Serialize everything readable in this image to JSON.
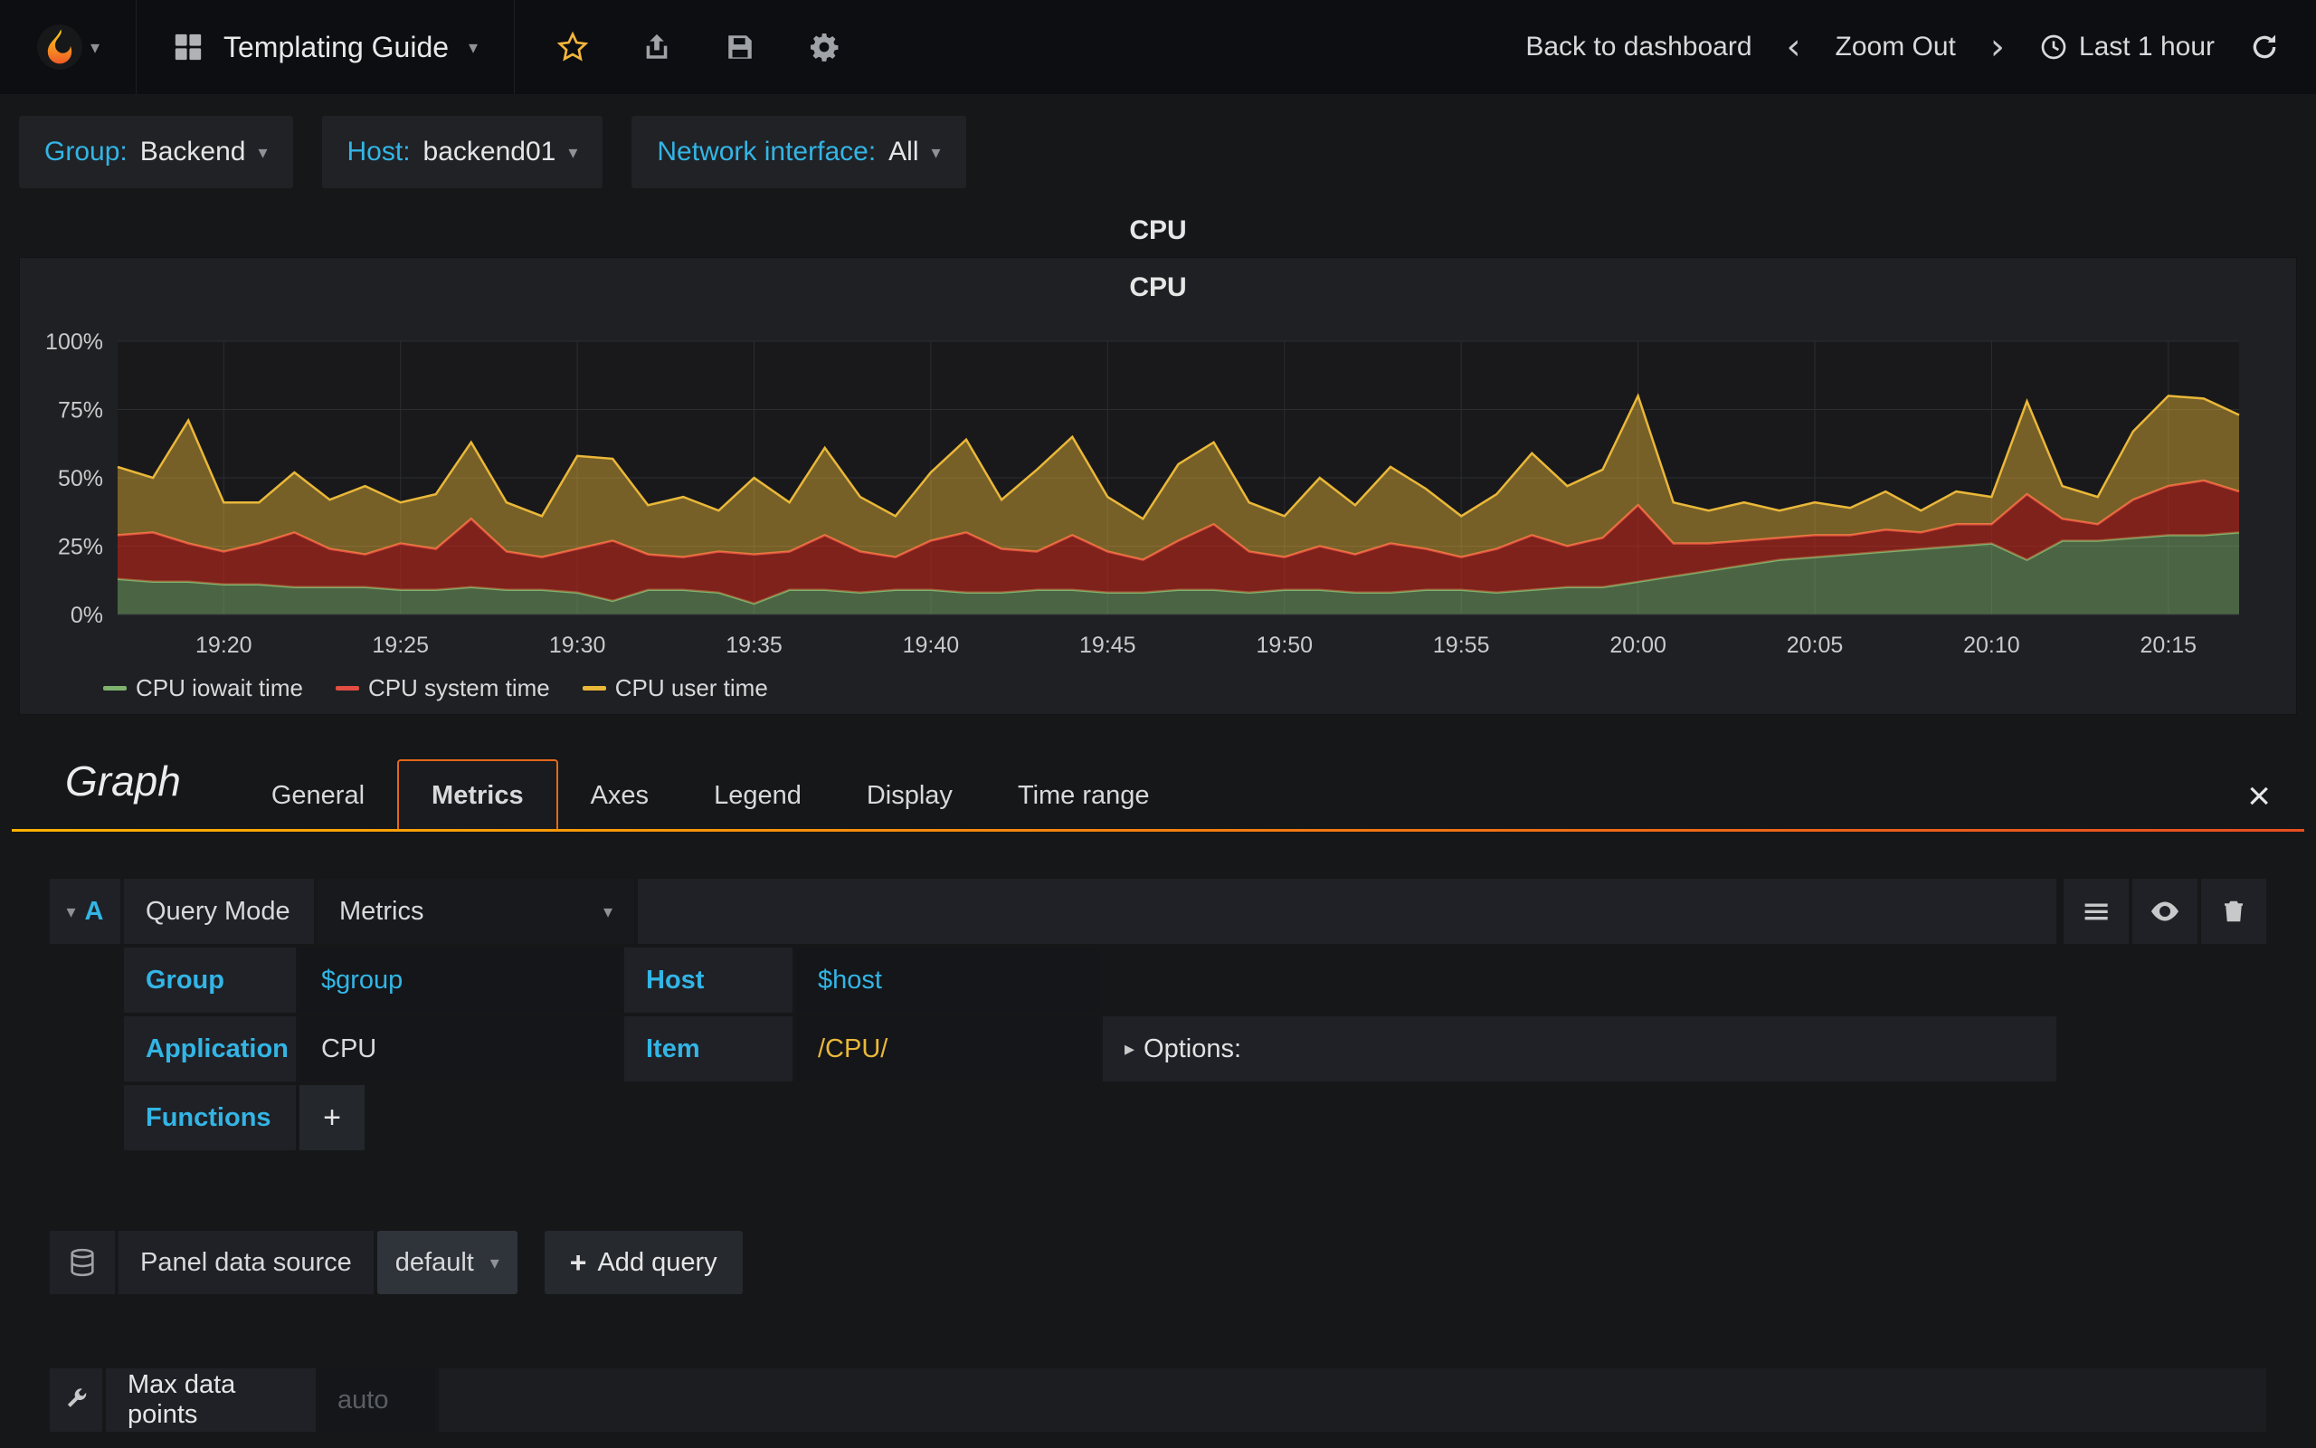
{
  "navbar": {
    "title": "Templating Guide",
    "back_to_dashboard": "Back to dashboard",
    "zoom_out": "Zoom Out",
    "time_range": "Last 1 hour"
  },
  "variables": [
    {
      "label": "Group:",
      "value": "Backend"
    },
    {
      "label": "Host:",
      "value": "backend01"
    },
    {
      "label": "Network interface:",
      "value": "All"
    }
  ],
  "panel": {
    "row_title": "CPU",
    "graph_title": "CPU"
  },
  "chart_data": {
    "type": "area",
    "stacked": true,
    "title": "CPU",
    "ylim": [
      0,
      100
    ],
    "y_ticks": [
      "0%",
      "25%",
      "50%",
      "75%",
      "100%"
    ],
    "x_ticks": [
      "19:20",
      "19:25",
      "19:30",
      "19:35",
      "19:40",
      "19:45",
      "19:50",
      "19:55",
      "20:00",
      "20:05",
      "20:10",
      "20:15"
    ],
    "first_tick_index": 3,
    "tick_step": 5,
    "x_start": "19:17",
    "x_end": "20:17",
    "grid": true,
    "legend_position": "bottom-left",
    "series": [
      {
        "name": "CPU iowait time",
        "color": "#7EB26D",
        "fill": "rgba(126,178,109,0.5)",
        "values": [
          13,
          12,
          12,
          11,
          11,
          10,
          10,
          10,
          9,
          9,
          10,
          9,
          9,
          8,
          5,
          9,
          9,
          8,
          4,
          9,
          9,
          8,
          9,
          9,
          8,
          8,
          9,
          9,
          8,
          8,
          9,
          9,
          8,
          9,
          9,
          8,
          8,
          9,
          9,
          8,
          9,
          10,
          10,
          12,
          14,
          16,
          18,
          20,
          21,
          22,
          23,
          24,
          25,
          26,
          20,
          27,
          27,
          28,
          29,
          29,
          30
        ]
      },
      {
        "name": "CPU system time",
        "color": "#E24D42",
        "fill": "rgba(190,40,28,0.62)",
        "values": [
          16,
          18,
          14,
          12,
          15,
          20,
          14,
          12,
          17,
          15,
          25,
          14,
          12,
          16,
          22,
          13,
          12,
          15,
          18,
          14,
          20,
          15,
          12,
          18,
          22,
          16,
          14,
          20,
          15,
          12,
          18,
          24,
          15,
          12,
          16,
          14,
          18,
          15,
          12,
          16,
          20,
          15,
          18,
          28,
          12,
          10,
          9,
          8,
          8,
          7,
          8,
          6,
          8,
          7,
          24,
          8,
          6,
          14,
          18,
          20,
          15
        ]
      },
      {
        "name": "CPU user time",
        "color": "#EAB839",
        "fill": "rgba(234,184,57,0.45)",
        "values": [
          25,
          20,
          45,
          18,
          15,
          22,
          18,
          25,
          15,
          20,
          28,
          18,
          15,
          34,
          30,
          18,
          22,
          15,
          28,
          18,
          32,
          20,
          15,
          25,
          34,
          18,
          30,
          36,
          20,
          15,
          28,
          30,
          18,
          15,
          25,
          18,
          28,
          22,
          15,
          20,
          30,
          22,
          25,
          40,
          15,
          12,
          14,
          10,
          12,
          10,
          14,
          8,
          12,
          10,
          34,
          12,
          10,
          25,
          33,
          30,
          28
        ]
      }
    ]
  },
  "editor": {
    "panel_type": "Graph",
    "tabs": [
      "General",
      "Metrics",
      "Axes",
      "Legend",
      "Display",
      "Time range"
    ],
    "active_tab": "Metrics",
    "query": {
      "ref_letter": "A",
      "query_mode_label": "Query Mode",
      "query_mode_value": "Metrics",
      "group_label": "Group",
      "group_value": "$group",
      "host_label": "Host",
      "host_value": "$host",
      "application_label": "Application",
      "application_value": "CPU",
      "item_label": "Item",
      "item_value": "/CPU/",
      "options_label": "Options:",
      "functions_label": "Functions",
      "add_function_label": "+"
    },
    "datasource_label": "Panel data source",
    "datasource_value": "default",
    "add_query_label": "Add query",
    "max_data_points_label": "Max data points",
    "max_data_points_placeholder": "auto"
  }
}
